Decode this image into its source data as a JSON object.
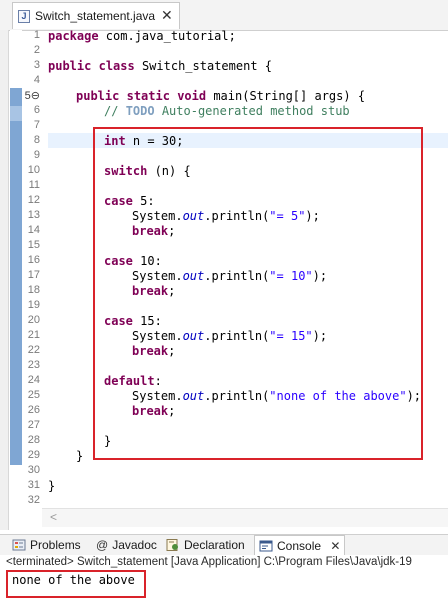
{
  "editor_tab": {
    "label": "Switch_statement.java",
    "close": "✕",
    "icon": "J"
  },
  "lines": [
    {
      "n": "1"
    },
    {
      "n": "2"
    },
    {
      "n": "3"
    },
    {
      "n": "4"
    },
    {
      "n": "5⊖"
    },
    {
      "n": "6"
    },
    {
      "n": "7"
    },
    {
      "n": "8"
    },
    {
      "n": "9"
    },
    {
      "n": "10"
    },
    {
      "n": "11"
    },
    {
      "n": "12"
    },
    {
      "n": "13"
    },
    {
      "n": "14"
    },
    {
      "n": "15"
    },
    {
      "n": "16"
    },
    {
      "n": "17"
    },
    {
      "n": "18"
    },
    {
      "n": "19"
    },
    {
      "n": "20"
    },
    {
      "n": "21"
    },
    {
      "n": "22"
    },
    {
      "n": "23"
    },
    {
      "n": "24"
    },
    {
      "n": "25"
    },
    {
      "n": "26"
    },
    {
      "n": "27"
    },
    {
      "n": "28"
    },
    {
      "n": "29"
    },
    {
      "n": "30"
    },
    {
      "n": "31"
    },
    {
      "n": "32"
    }
  ],
  "code": {
    "l1_kw": "package",
    "l1_rest": " com.java_tutorial;",
    "l3_kw1": "public",
    "l3_kw2": "class",
    "l3_rest": " Switch_statement {",
    "l5_kw1": "public",
    "l5_kw2": "static",
    "l5_kw3": "void",
    "l5_rest1": " main(String[] ",
    "l5_args": "args",
    "l5_rest2": ") {",
    "l6_c1": "// ",
    "l6_todo": "TODO",
    "l6_c2": " Auto-generated method stub",
    "l8_kw": "int",
    "l8_rest": " n = 30;",
    "l10_kw": "switch",
    "l10_rest": " (n) {",
    "l12_kw": "case",
    "l12_rest": " 5:",
    "l13_a": "System.",
    "l13_out": "out",
    "l13_b": ".println(",
    "l13_str": "\"= 5\"",
    "l13_c": ");",
    "l14_kw": "break",
    "l14_rest": ";",
    "l16_kw": "case",
    "l16_rest": " 10:",
    "l17_a": "System.",
    "l17_out": "out",
    "l17_b": ".println(",
    "l17_str": "\"= 10\"",
    "l17_c": ");",
    "l18_kw": "break",
    "l18_rest": ";",
    "l20_kw": "case",
    "l20_rest": " 15:",
    "l21_a": "System.",
    "l21_out": "out",
    "l21_b": ".println(",
    "l21_str": "\"= 15\"",
    "l21_c": ");",
    "l22_kw": "break",
    "l22_rest": ";",
    "l24_kw": "default",
    "l24_rest": ":",
    "l25_a": "System.",
    "l25_out": "out",
    "l25_b": ".println(",
    "l25_str": "\"none of the above\"",
    "l25_c": ");",
    "l26_kw": "break",
    "l26_rest": ";",
    "l28": "}",
    "l29": "}",
    "l31": "}"
  },
  "scroll_arrow": "<",
  "views": [
    {
      "label": "Problems",
      "icon": "problems-icon"
    },
    {
      "label": "Javadoc",
      "icon": "at-icon",
      "glyph": "@"
    },
    {
      "label": "Declaration",
      "icon": "declaration-icon"
    },
    {
      "label": "Console",
      "icon": "console-icon",
      "close": "✕"
    }
  ],
  "console": {
    "status": "<terminated> Switch_statement [Java Application] C:\\Program Files\\Java\\jdk-19",
    "output": "none of the above"
  },
  "colors": {
    "keyword": "#7f0055",
    "string": "#2a00ff",
    "comment": "#3f7f5f",
    "highlight_box": "#d9232a",
    "current_line": "#e8f2fe"
  }
}
